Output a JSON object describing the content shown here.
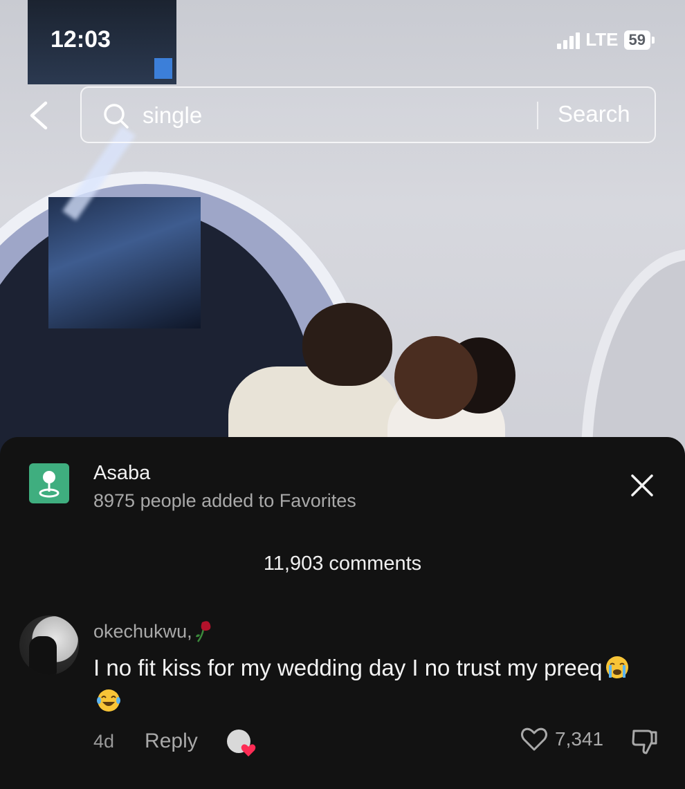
{
  "status_bar": {
    "time": "12:03",
    "network": "LTE",
    "battery": "59"
  },
  "search": {
    "query": "single",
    "button_label": "Search"
  },
  "place": {
    "name": "Asaba",
    "favorites_text": "8975 people added to Favorites",
    "icon": "location-pin-icon",
    "icon_color": "#3fae7f"
  },
  "comments": {
    "count_label": "11,903 comments",
    "items": [
      {
        "username": "okechukwu,",
        "text": "I no fit kiss for my wedding day I no trust my preeq",
        "emojis": [
          "loudly-crying-face",
          "tears-of-joy-face"
        ],
        "age": "4d",
        "reply_label": "Reply",
        "likes": "7,341"
      }
    ]
  },
  "colors": {
    "panel_background": "#121212",
    "text_primary": "#f3f3f3",
    "text_secondary": "#a9a9a9"
  }
}
